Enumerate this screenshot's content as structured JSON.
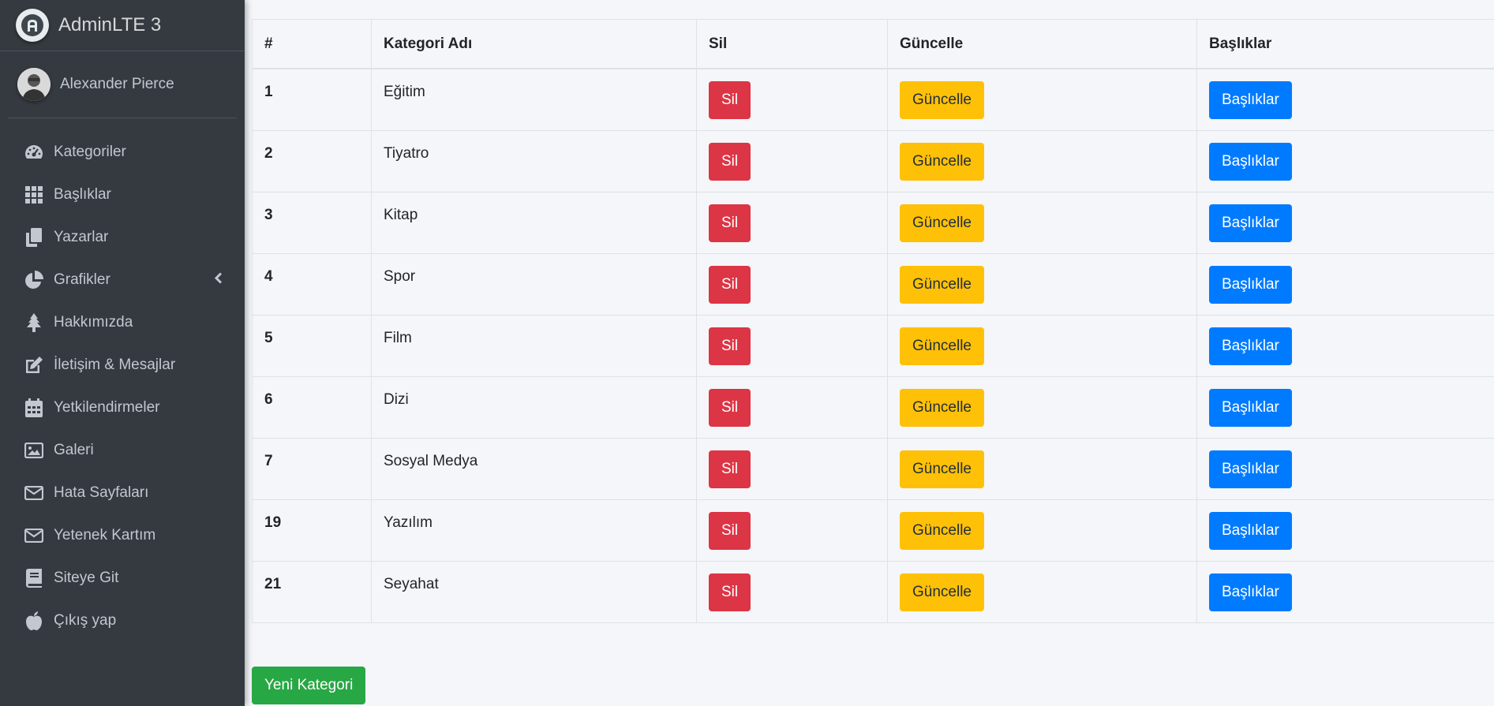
{
  "brand": {
    "title": "AdminLTE 3"
  },
  "user": {
    "name": "Alexander Pierce"
  },
  "sidebar": {
    "items": [
      {
        "label": "Kategoriler",
        "icon": "tachometer-icon"
      },
      {
        "label": "Başlıklar",
        "icon": "grid-icon"
      },
      {
        "label": "Yazarlar",
        "icon": "copy-icon"
      },
      {
        "label": "Grafikler",
        "icon": "pie-chart-icon",
        "has_submenu": true
      },
      {
        "label": "Hakkımızda",
        "icon": "tree-icon"
      },
      {
        "label": "İletişim & Mesajlar",
        "icon": "edit-icon"
      },
      {
        "label": "Yetkilendirmeler",
        "icon": "calendar-icon"
      },
      {
        "label": "Galeri",
        "icon": "image-icon"
      },
      {
        "label": "Hata Sayfaları",
        "icon": "envelope-icon"
      },
      {
        "label": "Yetenek Kartım",
        "icon": "envelope-icon"
      },
      {
        "label": "Siteye Git",
        "icon": "book-icon"
      },
      {
        "label": "Çıkış yap",
        "icon": "apple-icon"
      }
    ]
  },
  "table": {
    "headers": {
      "num": "#",
      "name": "Kategori Adı",
      "delete": "Sil",
      "update": "Güncelle",
      "titles": "Başlıklar"
    },
    "buttons": {
      "delete": "Sil",
      "update": "Güncelle",
      "titles": "Başlıklar"
    },
    "rows": [
      {
        "id": "1",
        "name": "Eğitim"
      },
      {
        "id": "2",
        "name": "Tiyatro"
      },
      {
        "id": "3",
        "name": "Kitap"
      },
      {
        "id": "4",
        "name": "Spor"
      },
      {
        "id": "5",
        "name": "Film"
      },
      {
        "id": "6",
        "name": "Dizi"
      },
      {
        "id": "7",
        "name": "Sosyal Medya"
      },
      {
        "id": "19",
        "name": "Yazılım"
      },
      {
        "id": "21",
        "name": "Seyahat"
      }
    ]
  },
  "new_category": {
    "label": "Yeni Kategori"
  },
  "colors": {
    "sidebar_bg": "#343a40",
    "danger": "#dc3545",
    "warning": "#ffc107",
    "primary": "#007bff",
    "success": "#28a745"
  }
}
